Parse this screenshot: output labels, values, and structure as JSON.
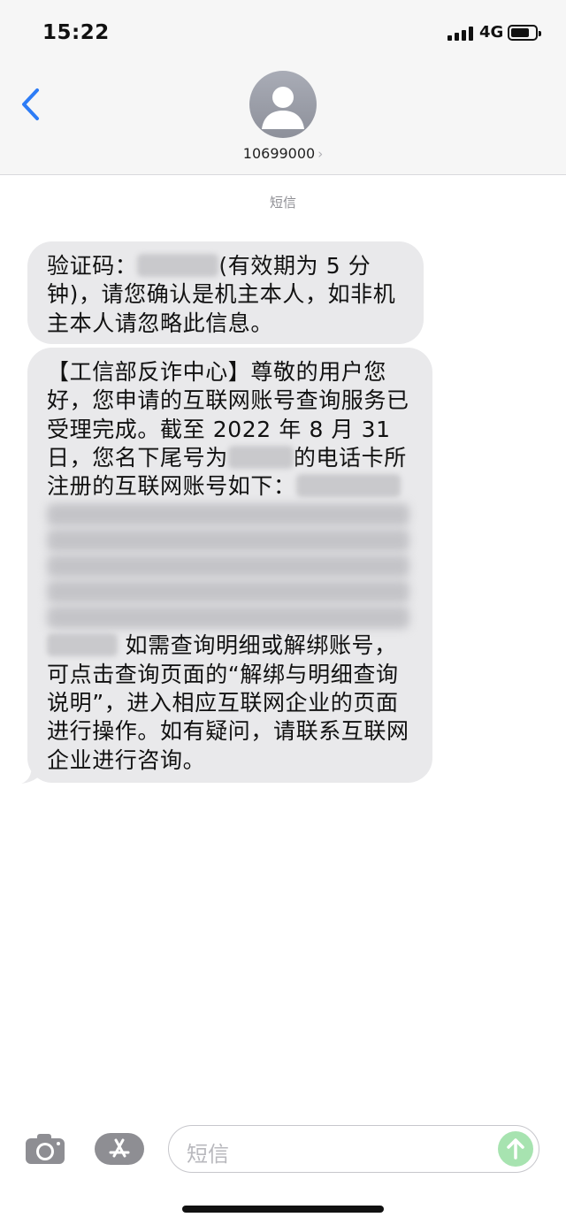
{
  "status_bar": {
    "time": "15:22",
    "network": "4G",
    "signal_bars": 4,
    "battery_level": 0.75
  },
  "header": {
    "back_icon": "chevron-left-icon",
    "avatar_icon": "person-icon",
    "contact": "10699000",
    "contact_chevron": "›"
  },
  "conversation": {
    "label": "短信",
    "messages": [
      {
        "part1": "验证码：",
        "part2": "(有效期为 5 分钟)，请您确认是机主本人，如非机主本人请忽略此信息。"
      },
      {
        "part1": "【工信部反诈中心】尊敬的用户您好，您申请的互联网账号查询服务已受理完成。截至 2022 年 8 月 31 日，您名下尾号为",
        "part2": "的电话卡所注册的互联网账号如下：",
        "part3": "如需查询明细或解绑账号，可点击查询页面的“解绑与明细查询说明”，进入相应互联网企业的页面进行操作。如有疑问，请联系互联网企业进行咨询。"
      }
    ]
  },
  "composer": {
    "camera_icon": "camera-icon",
    "apps_icon": "app-store-icon",
    "placeholder": "短信",
    "send_icon": "send-arrow-icon",
    "accent_color": "#34c759",
    "bubble_color": "#e9e9eb",
    "link_color": "#2d7cf6"
  }
}
